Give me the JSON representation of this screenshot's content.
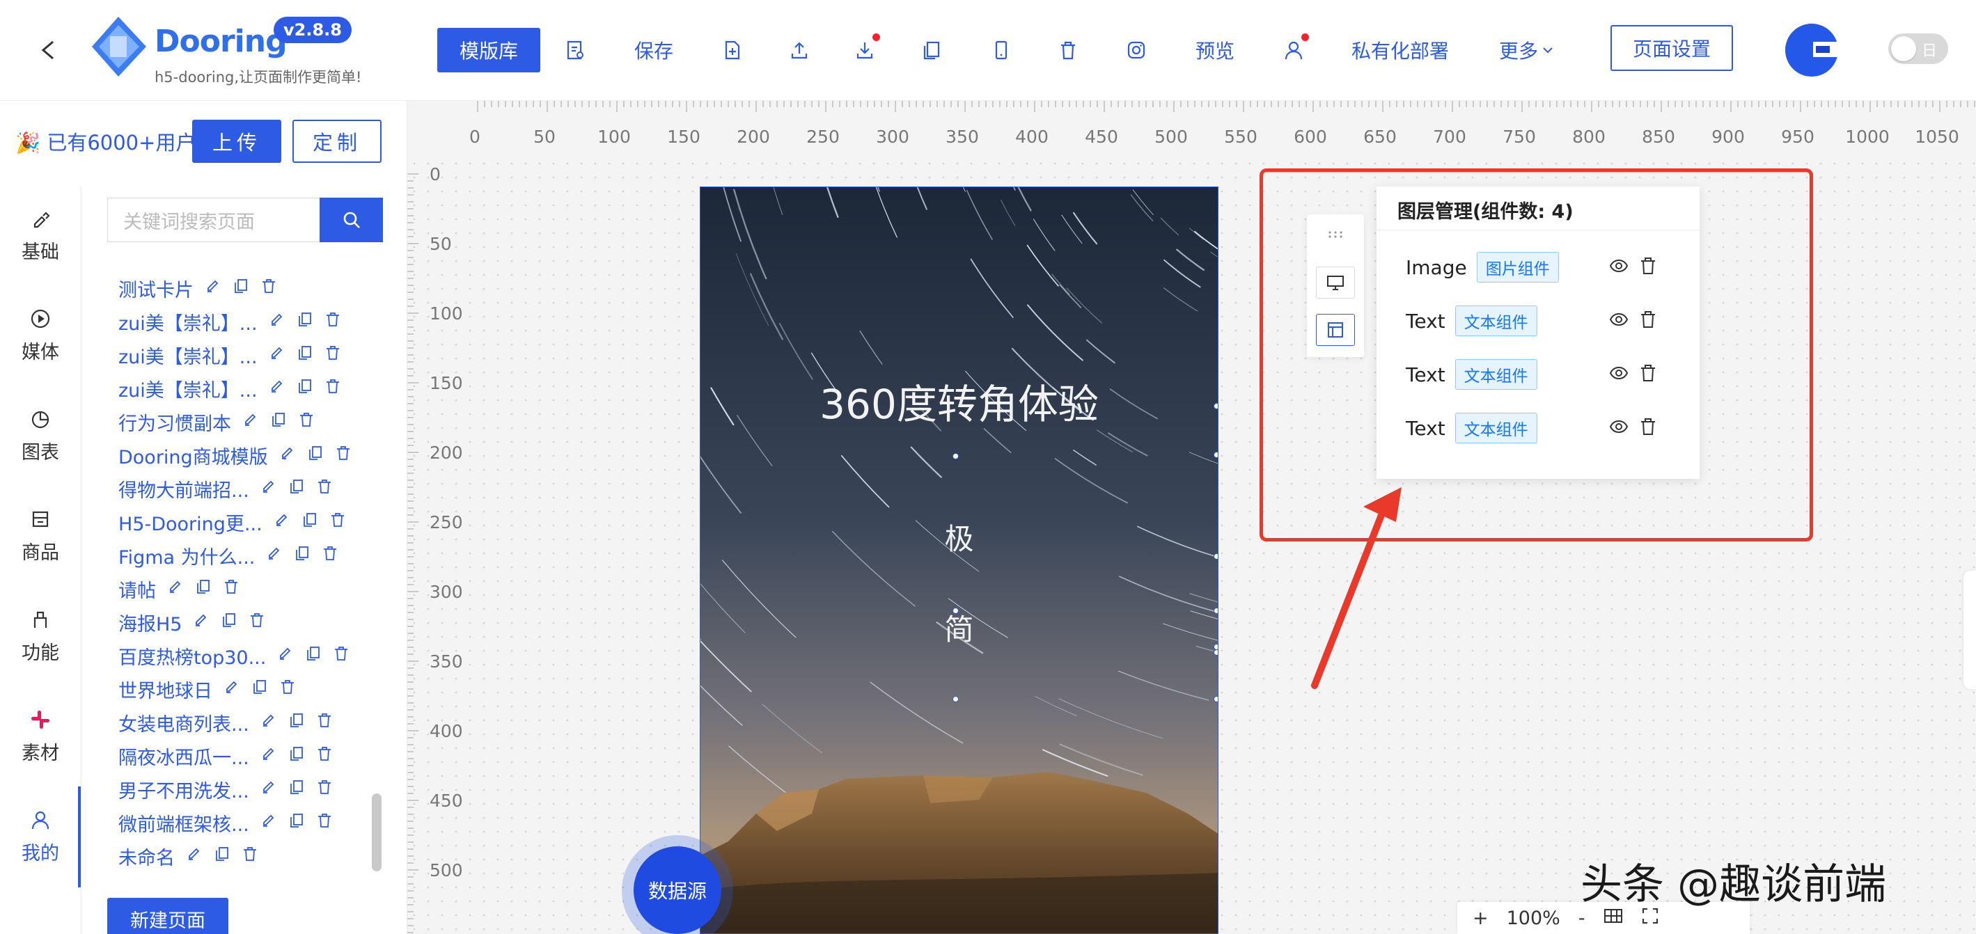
{
  "header": {
    "logo_text": "Dooring",
    "version": "v2.8.8",
    "slogan": "h5-dooring,让页面制作更简单!",
    "template_button": "模版库",
    "save_label": "保存",
    "preview_label": "预览",
    "private_deploy_label": "私有化部署",
    "more_label": "更多",
    "page_settings_button": "页面设置",
    "theme_toggle_label": "日"
  },
  "sidebar": {
    "users_banner": "🎉 已有6000+用户",
    "upload_button": "上传",
    "custom_button": "定制",
    "nav": [
      {
        "label": "基础",
        "icon": "brush-icon"
      },
      {
        "label": "媒体",
        "icon": "play-circle-icon"
      },
      {
        "label": "图表",
        "icon": "pie-chart-icon"
      },
      {
        "label": "商品",
        "icon": "shop-icon"
      },
      {
        "label": "功能",
        "icon": "tool-icon"
      },
      {
        "label": "素材",
        "icon": "slack-icon"
      },
      {
        "label": "我的",
        "icon": "user-icon"
      }
    ],
    "search_placeholder": "关键词搜索页面",
    "pages": [
      {
        "name": "测试卡片"
      },
      {
        "name": "zui美【崇礼】..."
      },
      {
        "name": "zui美【崇礼】..."
      },
      {
        "name": "zui美【崇礼】..."
      },
      {
        "name": "行为习惯副本"
      },
      {
        "name": "Dooring商城模版"
      },
      {
        "name": "得物大前端招..."
      },
      {
        "name": "H5-Dooring更..."
      },
      {
        "name": "Figma 为什么..."
      },
      {
        "name": "请帖"
      },
      {
        "name": "海报H5"
      },
      {
        "name": "百度热榜top30..."
      },
      {
        "name": "世界地球日"
      },
      {
        "name": "女装电商列表..."
      },
      {
        "name": "隔夜冰西瓜一..."
      },
      {
        "name": "男子不用洗发..."
      },
      {
        "name": "微前端框架核..."
      },
      {
        "name": "未命名"
      }
    ],
    "new_page_button": "新建页面"
  },
  "ruler": {
    "h_ticks": [
      "0",
      "50",
      "100",
      "150",
      "200",
      "250",
      "300",
      "350",
      "400",
      "450",
      "500",
      "550",
      "600",
      "650",
      "700",
      "750",
      "800",
      "850",
      "900",
      "950",
      "1000",
      "1050"
    ],
    "v_ticks": [
      "0",
      "50",
      "100",
      "150",
      "200",
      "250",
      "300",
      "350",
      "400",
      "450",
      "500"
    ]
  },
  "canvas": {
    "headline": "360度转角体验",
    "char1": "极",
    "char2": "简",
    "datasource_button": "数据源"
  },
  "layer_panel": {
    "title": "图层管理(组件数: 4)",
    "layers": [
      {
        "name": "Image",
        "tag": "图片组件"
      },
      {
        "name": "Text",
        "tag": "文本组件"
      },
      {
        "name": "Text",
        "tag": "文本组件"
      },
      {
        "name": "Text",
        "tag": "文本组件"
      }
    ]
  },
  "zoom": {
    "level": "100%",
    "plus": "+",
    "minus": "-"
  },
  "watermark": "头条 @趣谈前端",
  "colors": {
    "primary": "#2d5be3",
    "highlight_box": "#e8392b",
    "badge_dot": "#f5222d"
  }
}
